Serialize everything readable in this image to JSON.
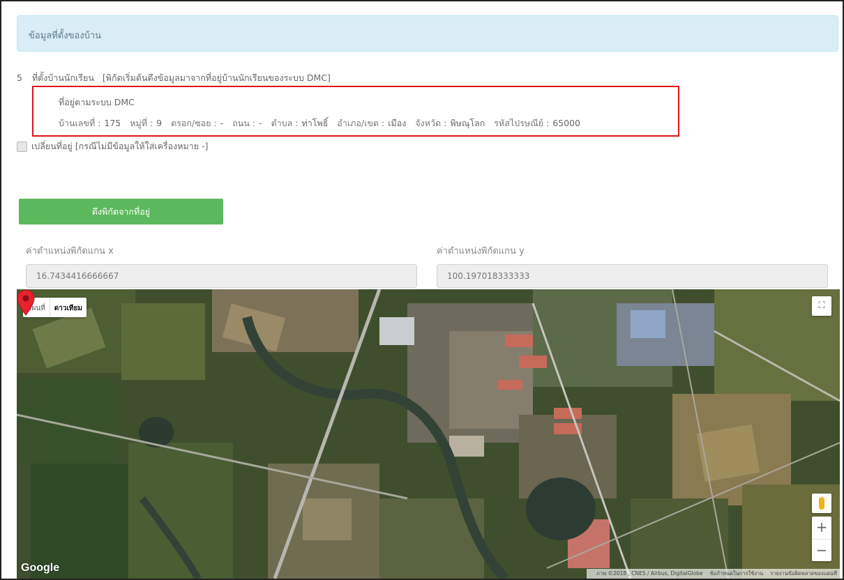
{
  "section": {
    "title": "ข้อมูลที่ตั้งของบ้าน"
  },
  "question": {
    "number": "5",
    "label": "ที่ตั้งบ้านนักเรียน",
    "note": "[พิกัดเริ่มต้นดึงข้อมูลมาจากที่อยู่บ้านนักเรียนของระบบ DMC]"
  },
  "dmc_address": {
    "title": "ที่อยู่ตามระบบ DMC",
    "fields": [
      {
        "label": "บ้านเลขที่ :",
        "value": "175"
      },
      {
        "label": "หมู่ที่ :",
        "value": "9"
      },
      {
        "label": "ตรอก/ซอย :",
        "value": "-"
      },
      {
        "label": "ถนน :",
        "value": "-"
      },
      {
        "label": "ตำบล :",
        "value": "ท่าโพธิ์"
      },
      {
        "label": "อำเภอ/เขต :",
        "value": "เมือง"
      },
      {
        "label": "จังหวัด :",
        "value": "พิษณุโลก"
      },
      {
        "label": "รหัสไปรษณีย์ :",
        "value": "65000"
      }
    ]
  },
  "change_address": {
    "label": "เปลี่ยนที่อยู่ [กรณีไม่มีข้อมูลให้ใส่เครื่องหมาย -]",
    "checked": false
  },
  "fetch_button": {
    "label": "ดึงพิกัดจากที่อยู่",
    "color": "#5cb85c"
  },
  "coords": {
    "x_label": "ค่าตำแหน่งพิกัดแกน x",
    "x_value": "16.7434416666667",
    "y_label": "ค่าตำแหน่งพิกัดแกน y",
    "y_value": "100.197018333333"
  },
  "map": {
    "type_buttons": [
      "แผนที่",
      "ดาวเทียม"
    ],
    "active_type": "ดาวเทียม",
    "logo": "Google",
    "footer": [
      "ภาพ ©2018 , CNES / Airbus, DigitalGlobe",
      "ข้อกำหนดในการใช้งาน",
      "รายงานข้อผิดพลาดของแผนที่"
    ],
    "zoom_in": "+",
    "zoom_out": "−",
    "fullscreen_icon": "fullscreen-icon",
    "pegman_icon": "pegman-icon",
    "marker_color": "#e8212d"
  }
}
